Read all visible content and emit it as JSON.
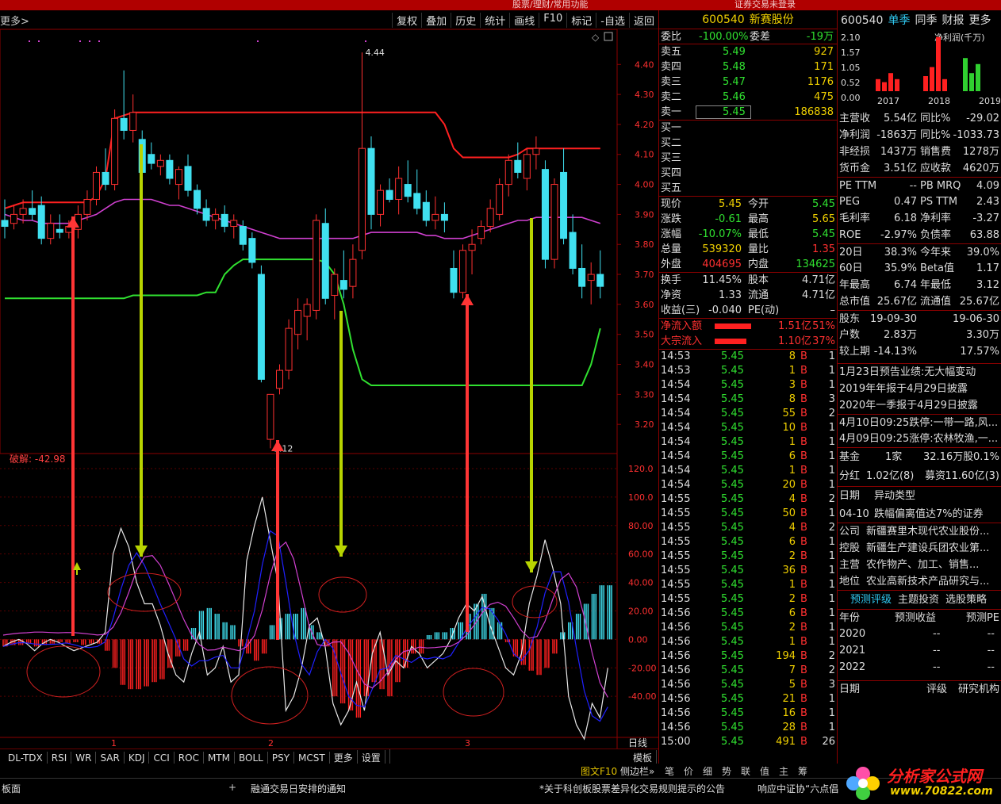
{
  "top_bar": {
    "center": "股票/理财/常用功能",
    "right": "证券交易未登录"
  },
  "toolbar": {
    "more": "更多>",
    "buttons": [
      "复权",
      "叠加",
      "历史",
      "统计",
      "画线",
      "F10",
      "标记",
      "-自选",
      "返回"
    ]
  },
  "price_axis": [
    "4.40",
    "4.30",
    "4.20",
    "4.10",
    "4.00",
    "3.90",
    "3.80",
    "3.70",
    "3.60",
    "3.50",
    "3.40",
    "3.30",
    "3.20"
  ],
  "osc_axis": [
    "120.0",
    "100.0",
    "80.00",
    "60.00",
    "40.00",
    "20.00",
    "0.00",
    "-20.00",
    "-40.00"
  ],
  "chart_labels": {
    "high": "4.44",
    "low": "3.12",
    "indicator": "破解: -42.98",
    "x_marks": [
      "1",
      "2",
      "3"
    ]
  },
  "tabs": [
    "DL-TDX",
    "RSI",
    "WR",
    "SAR",
    "KDJ",
    "CCI",
    "ROC",
    "MTM",
    "BOLL",
    "PSY",
    "MCST",
    "更多",
    "设置"
  ],
  "tab_right": "模板",
  "axis_corner": "日线",
  "quote": {
    "code": "600540",
    "name": "新赛股份",
    "weibi": {
      "label": "委比",
      "value": "-100.00%",
      "label2": "委差",
      "value2": "-19万"
    },
    "sells": [
      {
        "l": "卖五",
        "p": "5.49",
        "v": "927"
      },
      {
        "l": "卖四",
        "p": "5.48",
        "v": "171"
      },
      {
        "l": "卖三",
        "p": "5.47",
        "v": "1176"
      },
      {
        "l": "卖二",
        "p": "5.46",
        "v": "475"
      },
      {
        "l": "卖一",
        "p": "5.45",
        "v": "186838"
      }
    ],
    "buys": [
      "买一",
      "买二",
      "买三",
      "买四",
      "买五"
    ],
    "stats": [
      {
        "a": "现价",
        "b": "5.45",
        "c": "今开",
        "d": "5.45",
        "bc": "y",
        "dc": "g"
      },
      {
        "a": "涨跌",
        "b": "-0.61",
        "c": "最高",
        "d": "5.65",
        "bc": "g",
        "dc": "y"
      },
      {
        "a": "涨幅",
        "b": "-10.07%",
        "c": "最低",
        "d": "5.45",
        "bc": "g",
        "dc": "g"
      },
      {
        "a": "总量",
        "b": "539320",
        "c": "量比",
        "d": "1.35",
        "bc": "y",
        "dc": "r"
      },
      {
        "a": "外盘",
        "b": "404695",
        "c": "内盘",
        "d": "134625",
        "bc": "r",
        "dc": "g"
      }
    ],
    "stats2": [
      {
        "a": "换手",
        "b": "11.45%",
        "c": "股本",
        "d": "4.71亿"
      },
      {
        "a": "净资",
        "b": "1.33",
        "c": "流通",
        "d": "4.71亿"
      },
      {
        "a": "收益(三)",
        "b": "-0.040",
        "c": "PE(动)",
        "d": "–"
      }
    ],
    "flow": [
      {
        "label": "净流入额",
        "value": "1.51亿",
        "pct": "51%"
      },
      {
        "label": "大宗流入",
        "value": "1.10亿",
        "pct": "37%"
      }
    ],
    "ticks": [
      [
        "14:53",
        "5.45",
        "8",
        "B",
        "1"
      ],
      [
        "14:53",
        "5.45",
        "1",
        "B",
        "1"
      ],
      [
        "14:54",
        "5.45",
        "3",
        "B",
        "1"
      ],
      [
        "14:54",
        "5.45",
        "8",
        "B",
        "3"
      ],
      [
        "14:54",
        "5.45",
        "55",
        "B",
        "2"
      ],
      [
        "14:54",
        "5.45",
        "10",
        "B",
        "1"
      ],
      [
        "14:54",
        "5.45",
        "1",
        "B",
        "1"
      ],
      [
        "14:54",
        "5.45",
        "6",
        "B",
        "1"
      ],
      [
        "14:54",
        "5.45",
        "1",
        "B",
        "1"
      ],
      [
        "14:54",
        "5.45",
        "20",
        "B",
        "1"
      ],
      [
        "14:55",
        "5.45",
        "4",
        "B",
        "2"
      ],
      [
        "14:55",
        "5.45",
        "50",
        "B",
        "1"
      ],
      [
        "14:55",
        "5.45",
        "4",
        "B",
        "2"
      ],
      [
        "14:55",
        "5.45",
        "6",
        "B",
        "1"
      ],
      [
        "14:55",
        "5.45",
        "2",
        "B",
        "1"
      ],
      [
        "14:55",
        "5.45",
        "36",
        "B",
        "1"
      ],
      [
        "14:55",
        "5.45",
        "1",
        "B",
        "1"
      ],
      [
        "14:55",
        "5.45",
        "2",
        "B",
        "1"
      ],
      [
        "14:56",
        "5.45",
        "6",
        "B",
        "1"
      ],
      [
        "14:56",
        "5.45",
        "2",
        "B",
        "1"
      ],
      [
        "14:56",
        "5.45",
        "1",
        "B",
        "1"
      ],
      [
        "14:56",
        "5.45",
        "194",
        "B",
        "2"
      ],
      [
        "14:56",
        "5.45",
        "7",
        "B",
        "2"
      ],
      [
        "14:56",
        "5.45",
        "5",
        "B",
        "3"
      ],
      [
        "14:56",
        "5.45",
        "21",
        "B",
        "1"
      ],
      [
        "14:56",
        "5.45",
        "16",
        "B",
        "1"
      ],
      [
        "14:56",
        "5.45",
        "28",
        "B",
        "1"
      ],
      [
        "15:00",
        "5.45",
        "491",
        "B",
        "26"
      ]
    ]
  },
  "fin": {
    "header": [
      "600540",
      "单季",
      "同季",
      "财报",
      "更多"
    ],
    "mini_chart": {
      "title": "净利润(千万)",
      "yticks": [
        "2.10",
        "1.57",
        "1.05",
        "0.52",
        "0.00"
      ],
      "years": [
        "2017",
        "2018",
        "2019"
      ]
    },
    "rows": [
      [
        "主营收",
        "5.54亿",
        "同比%",
        "-29.02"
      ],
      [
        "净利润",
        "-1863万",
        "同比%",
        "-1033.73"
      ],
      [
        "非经损",
        "1437万",
        "销售费",
        "1278万"
      ],
      [
        "货币金",
        "3.51亿",
        "应收款",
        "4620万"
      ],
      [
        "PE TTM",
        "--",
        "PB MRQ",
        "4.09"
      ],
      [
        "PEG",
        "0.47",
        "PS TTM",
        "2.43"
      ],
      [
        "毛利率",
        "6.18",
        "净利率",
        "-3.27"
      ],
      [
        "ROE",
        "-2.97%",
        "负债率",
        "63.88"
      ],
      [
        "20日",
        "38.3%",
        "今年来",
        "39.0%"
      ],
      [
        "60日",
        "35.9%",
        "Beta值",
        "1.17"
      ],
      [
        "年最高",
        "6.74",
        "年最低",
        "3.12"
      ],
      [
        "总市值",
        "25.67亿",
        "流通值",
        "25.67亿"
      ],
      [
        "股东",
        "19-09-30",
        "",
        "19-06-30"
      ],
      [
        "户数",
        "2.83万",
        "",
        "3.30万"
      ],
      [
        "较上期",
        "-14.13%",
        "",
        "17.57%"
      ]
    ],
    "notes": [
      "1月23日预告业绩:无大幅变动",
      "2019年年报于4月29日披露",
      "2020年一季报于4月29日披露",
      "4月10日09:25跌停:一带一路,风...",
      "4月09日09:25涨停:农林牧渔,一..."
    ],
    "fund": [
      "基金",
      "1家",
      "32.16万股",
      "0.1%"
    ],
    "dividend": [
      "分红",
      "1.02亿(8)",
      "募资",
      "11.60亿(3)"
    ],
    "events": {
      "h1": "日期",
      "h2": "异动类型",
      "date": "04-10",
      "text": "跌幅偏离值达7%的证券"
    },
    "company": [
      [
        "公司",
        "新疆赛里木现代农业股份..."
      ],
      [
        "控股",
        "新疆生产建设兵团农业第..."
      ],
      [
        "主营",
        "农作物产、加工、销售..."
      ],
      [
        "地位",
        "农业高新技术产品研究与..."
      ]
    ],
    "tabs2": [
      "预测评级",
      "主题投资",
      "选股策略"
    ],
    "forecast_head": [
      "年份",
      "预测收益",
      "预测PE"
    ],
    "forecast": [
      [
        "2020",
        "--",
        "--"
      ],
      [
        "2021",
        "--",
        "--"
      ],
      [
        "2022",
        "--",
        "--"
      ]
    ],
    "rating_head": [
      "日期",
      "评级",
      "研究机构"
    ]
  },
  "subbar": {
    "f10": "图文F10",
    "side": "侧边栏»",
    "icons": "笔价细势联值主筹"
  },
  "status": {
    "a": "板面",
    "b": "融通交易日安排的通知",
    "c": "*关于科创板股票差异化交易规则提示的公告",
    "d": "响应中证协“六点倡"
  },
  "logo": {
    "t1": "分析家公式网",
    "t2": "www.70822.com"
  },
  "chart_data": {
    "type": "candlestick",
    "ylim": [
      3.1,
      4.48
    ],
    "candles": [
      [
        3.88,
        3.95,
        3.82,
        3.86
      ],
      [
        3.87,
        3.93,
        3.85,
        3.9
      ],
      [
        3.9,
        3.95,
        3.87,
        3.92
      ],
      [
        3.92,
        3.98,
        3.88,
        3.9
      ],
      [
        3.93,
        3.96,
        3.8,
        3.82
      ],
      [
        3.82,
        3.9,
        3.8,
        3.87
      ],
      [
        3.85,
        3.9,
        3.82,
        3.84
      ],
      [
        3.84,
        3.88,
        3.82,
        3.86
      ],
      [
        3.85,
        3.93,
        3.82,
        3.9
      ],
      [
        3.9,
        3.98,
        3.88,
        3.95
      ],
      [
        3.95,
        4.06,
        3.93,
        4.04
      ],
      [
        4.04,
        4.12,
        3.98,
        4.0
      ],
      [
        4.0,
        4.25,
        3.98,
        4.22
      ],
      [
        4.22,
        4.38,
        4.15,
        4.18
      ],
      [
        4.18,
        4.3,
        4.14,
        4.24
      ],
      [
        4.15,
        4.18,
        4.02,
        4.04
      ],
      [
        4.1,
        4.14,
        4.05,
        4.07
      ],
      [
        4.06,
        4.1,
        4.03,
        4.08
      ],
      [
        4.08,
        4.1,
        4.0,
        4.02
      ],
      [
        4.0,
        4.06,
        3.95,
        4.05
      ],
      [
        4.06,
        4.1,
        3.96,
        3.98
      ],
      [
        3.98,
        4.0,
        3.9,
        3.92
      ],
      [
        3.92,
        3.95,
        3.86,
        3.88
      ],
      [
        3.88,
        3.92,
        3.85,
        3.9
      ],
      [
        3.9,
        3.93,
        3.84,
        3.86
      ],
      [
        3.86,
        3.9,
        3.82,
        3.88
      ],
      [
        3.86,
        3.88,
        3.78,
        3.8
      ],
      [
        3.82,
        3.84,
        3.72,
        3.74
      ],
      [
        3.7,
        3.73,
        3.34,
        3.35
      ],
      [
        3.15,
        3.3,
        3.12,
        3.3
      ],
      [
        3.32,
        3.4,
        3.3,
        3.38
      ],
      [
        3.38,
        3.55,
        3.35,
        3.52
      ],
      [
        3.5,
        3.62,
        3.45,
        3.58
      ],
      [
        3.56,
        3.62,
        3.48,
        3.6
      ],
      [
        3.58,
        3.9,
        3.55,
        3.88
      ],
      [
        3.87,
        3.92,
        3.6,
        3.62
      ],
      [
        3.63,
        3.72,
        3.55,
        3.7
      ],
      [
        3.68,
        3.78,
        3.62,
        3.65
      ],
      [
        3.66,
        3.8,
        3.62,
        3.75
      ],
      [
        3.78,
        4.44,
        3.75,
        4.12
      ],
      [
        4.12,
        4.16,
        3.85,
        3.9
      ],
      [
        3.9,
        4.0,
        3.86,
        3.98
      ],
      [
        3.98,
        4.02,
        3.94,
        3.95
      ],
      [
        3.95,
        4.06,
        3.9,
        4.02
      ],
      [
        4.0,
        4.08,
        3.94,
        3.96
      ],
      [
        3.97,
        4.05,
        3.9,
        3.92
      ],
      [
        3.94,
        3.98,
        3.86,
        3.88
      ],
      [
        3.88,
        3.96,
        3.85,
        3.9
      ],
      [
        3.9,
        3.94,
        3.84,
        3.88
      ],
      [
        3.72,
        3.78,
        3.62,
        3.64
      ],
      [
        3.64,
        3.8,
        3.62,
        3.78
      ],
      [
        3.78,
        3.85,
        3.7,
        3.8
      ],
      [
        3.82,
        3.88,
        3.8,
        3.86
      ],
      [
        3.86,
        3.95,
        3.84,
        3.92
      ],
      [
        3.9,
        4.02,
        3.88,
        4.0
      ],
      [
        4.0,
        4.1,
        3.96,
        4.08
      ],
      [
        4.08,
        4.14,
        4.02,
        4.04
      ],
      [
        4.02,
        4.12,
        3.98,
        4.1
      ],
      [
        4.1,
        4.16,
        4.05,
        4.12
      ],
      [
        4.05,
        4.08,
        3.72,
        3.75
      ],
      [
        3.75,
        4.02,
        3.72,
        4.0
      ],
      [
        4.04,
        4.12,
        3.8,
        3.82
      ],
      [
        3.84,
        3.9,
        3.7,
        3.72
      ],
      [
        3.72,
        3.8,
        3.62,
        3.66
      ],
      [
        3.68,
        3.74,
        3.6,
        3.7
      ],
      [
        3.7,
        3.78,
        3.62,
        3.66
      ]
    ],
    "upper_line": [
      3.92,
      3.93,
      3.94,
      3.94,
      3.94,
      3.94,
      3.94,
      3.94,
      3.94,
      3.94,
      3.96,
      4.02,
      4.22,
      4.23,
      4.24,
      4.24,
      4.24,
      4.24,
      4.24,
      4.24,
      4.24,
      4.24,
      4.24,
      4.24,
      4.24,
      4.24,
      4.24,
      4.24,
      4.24,
      4.24,
      4.24,
      4.24,
      4.24,
      4.24,
      4.24,
      4.24,
      4.24,
      4.24,
      4.24,
      4.24,
      4.24,
      4.24,
      4.24,
      4.24,
      4.24,
      4.24,
      4.24,
      4.24,
      4.2,
      4.12,
      4.09,
      4.09,
      4.09,
      4.09,
      4.09,
      4.09,
      4.1,
      4.12,
      4.12,
      4.12,
      4.12,
      4.12,
      4.12,
      4.12,
      4.12,
      4.12
    ],
    "ma_line": [
      3.9,
      3.89,
      3.88,
      3.88,
      3.87,
      3.87,
      3.87,
      3.87,
      3.88,
      3.89,
      3.9,
      3.92,
      3.94,
      3.95,
      3.95,
      3.95,
      3.95,
      3.94,
      3.93,
      3.93,
      3.92,
      3.91,
      3.9,
      3.89,
      3.88,
      3.87,
      3.86,
      3.85,
      3.84,
      3.83,
      3.82,
      3.82,
      3.82,
      3.82,
      3.82,
      3.82,
      3.82,
      3.82,
      3.82,
      3.83,
      3.84,
      3.84,
      3.84,
      3.84,
      3.84,
      3.84,
      3.83,
      3.83,
      3.82,
      3.82,
      3.82,
      3.83,
      3.84,
      3.85,
      3.86,
      3.87,
      3.88,
      3.88,
      3.89,
      3.89,
      3.89,
      3.89,
      3.89,
      3.89,
      3.88,
      3.87
    ],
    "lower_line": [
      3.62,
      3.62,
      3.62,
      3.62,
      3.62,
      3.62,
      3.62,
      3.62,
      3.62,
      3.62,
      3.62,
      3.62,
      3.62,
      3.62,
      3.63,
      3.63,
      3.63,
      3.63,
      3.63,
      3.63,
      3.63,
      3.63,
      3.64,
      3.64,
      3.7,
      3.73,
      3.75,
      3.75,
      3.75,
      3.75,
      3.75,
      3.75,
      3.75,
      3.75,
      3.75,
      3.74,
      3.7,
      3.6,
      3.45,
      3.35,
      3.33,
      3.33,
      3.33,
      3.33,
      3.33,
      3.33,
      3.33,
      3.33,
      3.33,
      3.33,
      3.33,
      3.33,
      3.33,
      3.33,
      3.33,
      3.33,
      3.33,
      3.33,
      3.33,
      3.33,
      3.33,
      3.33,
      3.33,
      3.33,
      3.4,
      3.52
    ],
    "osc_ylim": [
      -70,
      125
    ],
    "hist": [
      -5,
      -4,
      -4,
      -3,
      -5,
      -4,
      -3,
      -2,
      -3,
      -2,
      -4,
      -3,
      -3,
      -8,
      -20,
      -32,
      -35,
      -35,
      -33,
      -30,
      -28,
      -20,
      -12,
      -8,
      8,
      20,
      22,
      18,
      12,
      10,
      -5,
      -10,
      -15,
      -10,
      10,
      15,
      18,
      18,
      22,
      10,
      5,
      -5,
      -40,
      -45,
      -50,
      -55,
      -40,
      -30,
      -35,
      -40,
      -30,
      -20,
      -10,
      -10,
      3,
      5,
      5,
      8,
      12,
      18,
      25,
      32,
      22,
      12,
      -2,
      -12,
      -18,
      -22,
      -25,
      -20,
      -10,
      5,
      12,
      18,
      25,
      32,
      38,
      38
    ],
    "white": [
      -5,
      -2,
      0,
      -3,
      -8,
      -3,
      0,
      -2,
      -5,
      -8,
      -6,
      -4,
      -2,
      5,
      60,
      78,
      65,
      40,
      25,
      25,
      10,
      -10,
      -25,
      -30,
      -10,
      5,
      -25,
      -20,
      -5,
      -30,
      -25,
      55,
      80,
      100,
      70,
      40,
      -50,
      -40,
      -20,
      10,
      15,
      -5,
      -45,
      -60,
      -50,
      -30,
      -50,
      -10,
      5,
      -25,
      -15,
      -20,
      -5,
      -10,
      -20,
      -15,
      -10,
      0,
      15,
      25,
      20,
      30,
      10,
      -5,
      -20,
      -25,
      -10,
      25,
      45,
      70,
      50,
      25,
      -40,
      -60,
      -70,
      -45,
      -55,
      -20
    ]
  }
}
